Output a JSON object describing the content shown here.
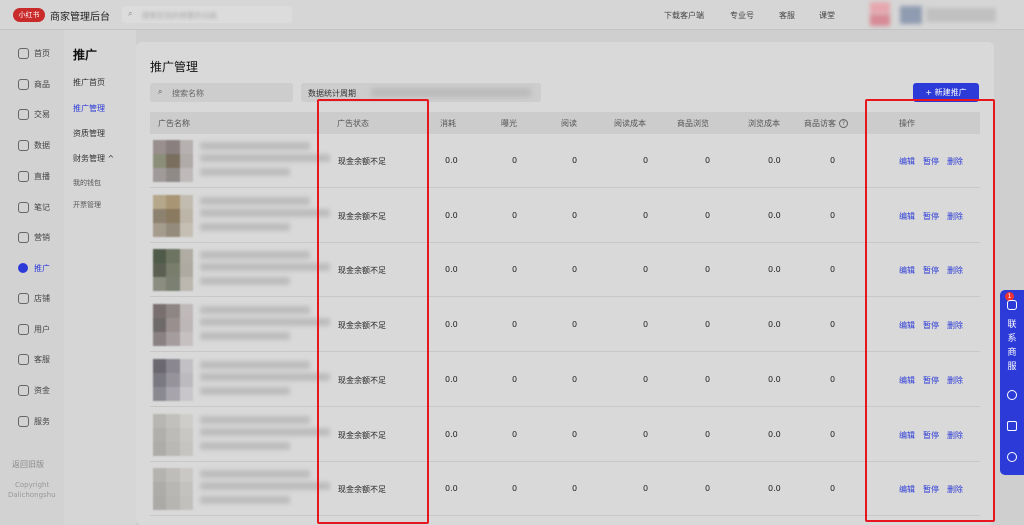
{
  "header": {
    "logo_text": "小红书",
    "brand": "商家管理后台",
    "search_placeholder": "搜索您找的想要的功能",
    "links": [
      "下载客户端",
      "专业号",
      "客服",
      "课堂"
    ]
  },
  "sidebar": {
    "items": [
      {
        "label": "首页",
        "icon": "home-icon"
      },
      {
        "label": "商品",
        "icon": "goods-icon"
      },
      {
        "label": "交易",
        "icon": "trade-icon"
      },
      {
        "label": "数据",
        "icon": "data-icon"
      },
      {
        "label": "直播",
        "icon": "live-icon"
      },
      {
        "label": "笔记",
        "icon": "notes-icon"
      },
      {
        "label": "营销",
        "icon": "megaphone-icon"
      },
      {
        "label": "推广",
        "icon": "promote-icon"
      },
      {
        "label": "店铺",
        "icon": "store-icon"
      },
      {
        "label": "用户",
        "icon": "users-icon"
      },
      {
        "label": "客服",
        "icon": "service-icon"
      },
      {
        "label": "资金",
        "icon": "money-icon"
      },
      {
        "label": "服务",
        "icon": "shield-icon"
      }
    ],
    "active_index": 7,
    "footer_link": "返回旧版",
    "copyright": "Copyright",
    "copyright_sub": "Dalichongshu"
  },
  "subnav": {
    "title": "推广",
    "items": [
      {
        "label": "推广首页"
      },
      {
        "label": "推广管理"
      },
      {
        "label": "资质管理"
      },
      {
        "label": "财务管理 ^"
      },
      {
        "label": "我的钱包"
      },
      {
        "label": "开票管理"
      }
    ],
    "active_index": 1
  },
  "main": {
    "title": "推广管理",
    "search_placeholder": "搜索名称",
    "date_label": "数据统计周期",
    "new_button": "+ 新建推广",
    "columns": [
      "广告名称",
      "广告状态",
      "消耗",
      "曝光",
      "阅读",
      "阅读成本",
      "商品浏览",
      "浏览成本",
      "商品访客",
      "操作"
    ],
    "rows": [
      {
        "status": "现金余额不足",
        "cost": "0.0",
        "impressions": "0",
        "reads": "0",
        "read_cost": "0",
        "views": "0",
        "view_cost": "0.0",
        "visitors": "0"
      },
      {
        "status": "现金余额不足",
        "cost": "0.0",
        "impressions": "0",
        "reads": "0",
        "read_cost": "0",
        "views": "0",
        "view_cost": "0.0",
        "visitors": "0"
      },
      {
        "status": "现金余额不足",
        "cost": "0.0",
        "impressions": "0",
        "reads": "0",
        "read_cost": "0",
        "views": "0",
        "view_cost": "0.0",
        "visitors": "0"
      },
      {
        "status": "现金余额不足",
        "cost": "0.0",
        "impressions": "0",
        "reads": "0",
        "read_cost": "0",
        "views": "0",
        "view_cost": "0.0",
        "visitors": "0"
      },
      {
        "status": "现金余额不足",
        "cost": "0.0",
        "impressions": "0",
        "reads": "0",
        "read_cost": "0",
        "views": "0",
        "view_cost": "0.0",
        "visitors": "0"
      },
      {
        "status": "现金余额不足",
        "cost": "0.0",
        "impressions": "0",
        "reads": "0",
        "read_cost": "0",
        "views": "0",
        "view_cost": "0.0",
        "visitors": "0"
      },
      {
        "status": "现金余额不足",
        "cost": "0.0",
        "impressions": "0",
        "reads": "0",
        "read_cost": "0",
        "views": "0",
        "view_cost": "0.0",
        "visitors": "0"
      }
    ],
    "actions": [
      "编辑",
      "暂停",
      "删除"
    ]
  },
  "floatbar": {
    "badge": "1",
    "label": [
      "联",
      "系",
      "商",
      "服"
    ]
  },
  "colors": {
    "accent": "#2c3bd8",
    "highlight": "#e8141e",
    "logo": "#c92a2a"
  }
}
